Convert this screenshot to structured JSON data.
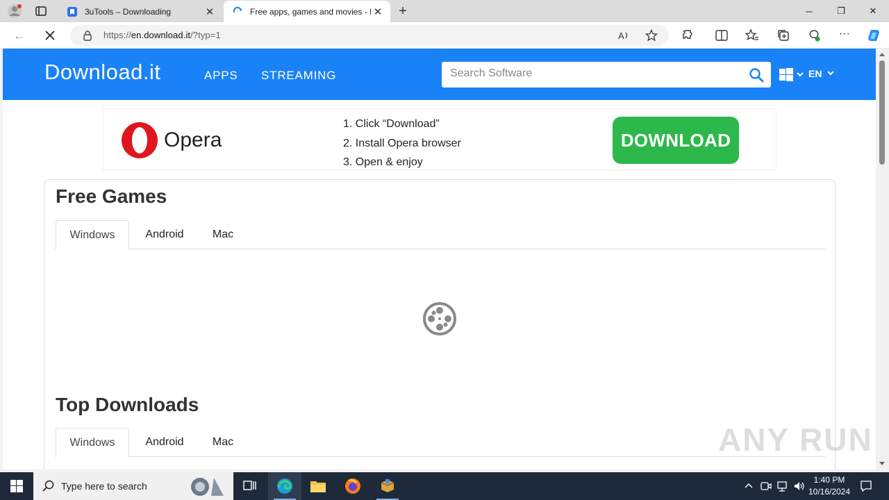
{
  "browser": {
    "tabs": [
      {
        "title": "3uTools – Downloading",
        "active": false
      },
      {
        "title": "Free apps, games and movies - D",
        "active": true
      }
    ],
    "url_prefix": "https://",
    "url_domain": "en.download.it",
    "url_path": "/?typ=1",
    "window_controls": {
      "minimize": "─",
      "restore": "❐",
      "close": "✕"
    }
  },
  "site": {
    "logo": "Download.it",
    "nav": [
      "APPS",
      "STREAMING"
    ],
    "search_placeholder": "Search Software",
    "language": "EN",
    "brand_color": "#1a82f7"
  },
  "ad": {
    "brand": "Opera",
    "steps": [
      "1. Click “Download”",
      "2. Install Opera browser",
      "3. Open & enjoy"
    ],
    "button": "DOWNLOAD",
    "button_color": "#2db84b"
  },
  "sections": [
    {
      "title": "Free Games",
      "tabs": [
        "Windows",
        "Android",
        "Mac"
      ],
      "active_tab": "Windows"
    },
    {
      "title": "Top Downloads",
      "tabs": [
        "Windows",
        "Android",
        "Mac"
      ],
      "active_tab": "Windows"
    }
  ],
  "watermark": "ANY RUN",
  "taskbar": {
    "search_placeholder": "Type here to search",
    "time": "1:40 PM",
    "date": "10/16/2024"
  }
}
